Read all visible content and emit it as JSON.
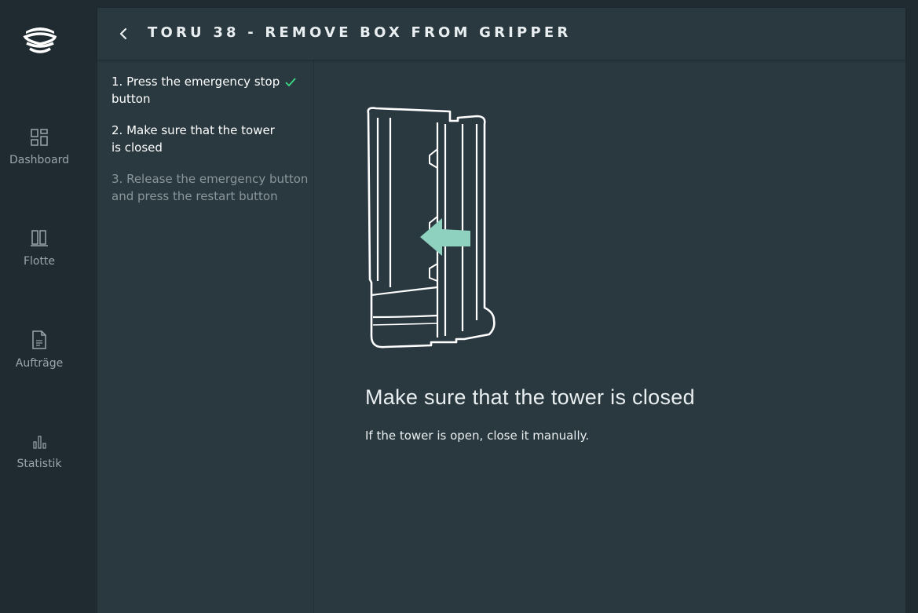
{
  "sidebar": {
    "logo_icon": "stacked-bowls-logo",
    "items": [
      {
        "label": "Dashboard",
        "icon": "dashboard-icon"
      },
      {
        "label": "Flotte",
        "icon": "fleet-icon"
      },
      {
        "label": "Aufträge",
        "icon": "document-icon"
      },
      {
        "label": "Statistik",
        "icon": "bar-chart-icon"
      }
    ]
  },
  "header": {
    "back_icon": "chevron-left-icon",
    "title": "TORU 38 - REMOVE BOX FROM GRIPPER"
  },
  "steps": [
    {
      "line1": "1. Press the emergency stop",
      "line2": "button",
      "done": true
    },
    {
      "text": "2. Make sure that the tower is closed",
      "done": false
    },
    {
      "text": "3. Release the emergency button and press the restart button",
      "done": false
    }
  ],
  "instruction": {
    "title": "Make sure that the tower is closed",
    "text": "If the tower is open, close it manually."
  },
  "colors": {
    "sidebar_bg": "#1f2b31",
    "panel_bg": "#2a3940",
    "check": "#3ddc84",
    "arrow": "#8fd1bf",
    "muted_text": "#8a969b"
  }
}
